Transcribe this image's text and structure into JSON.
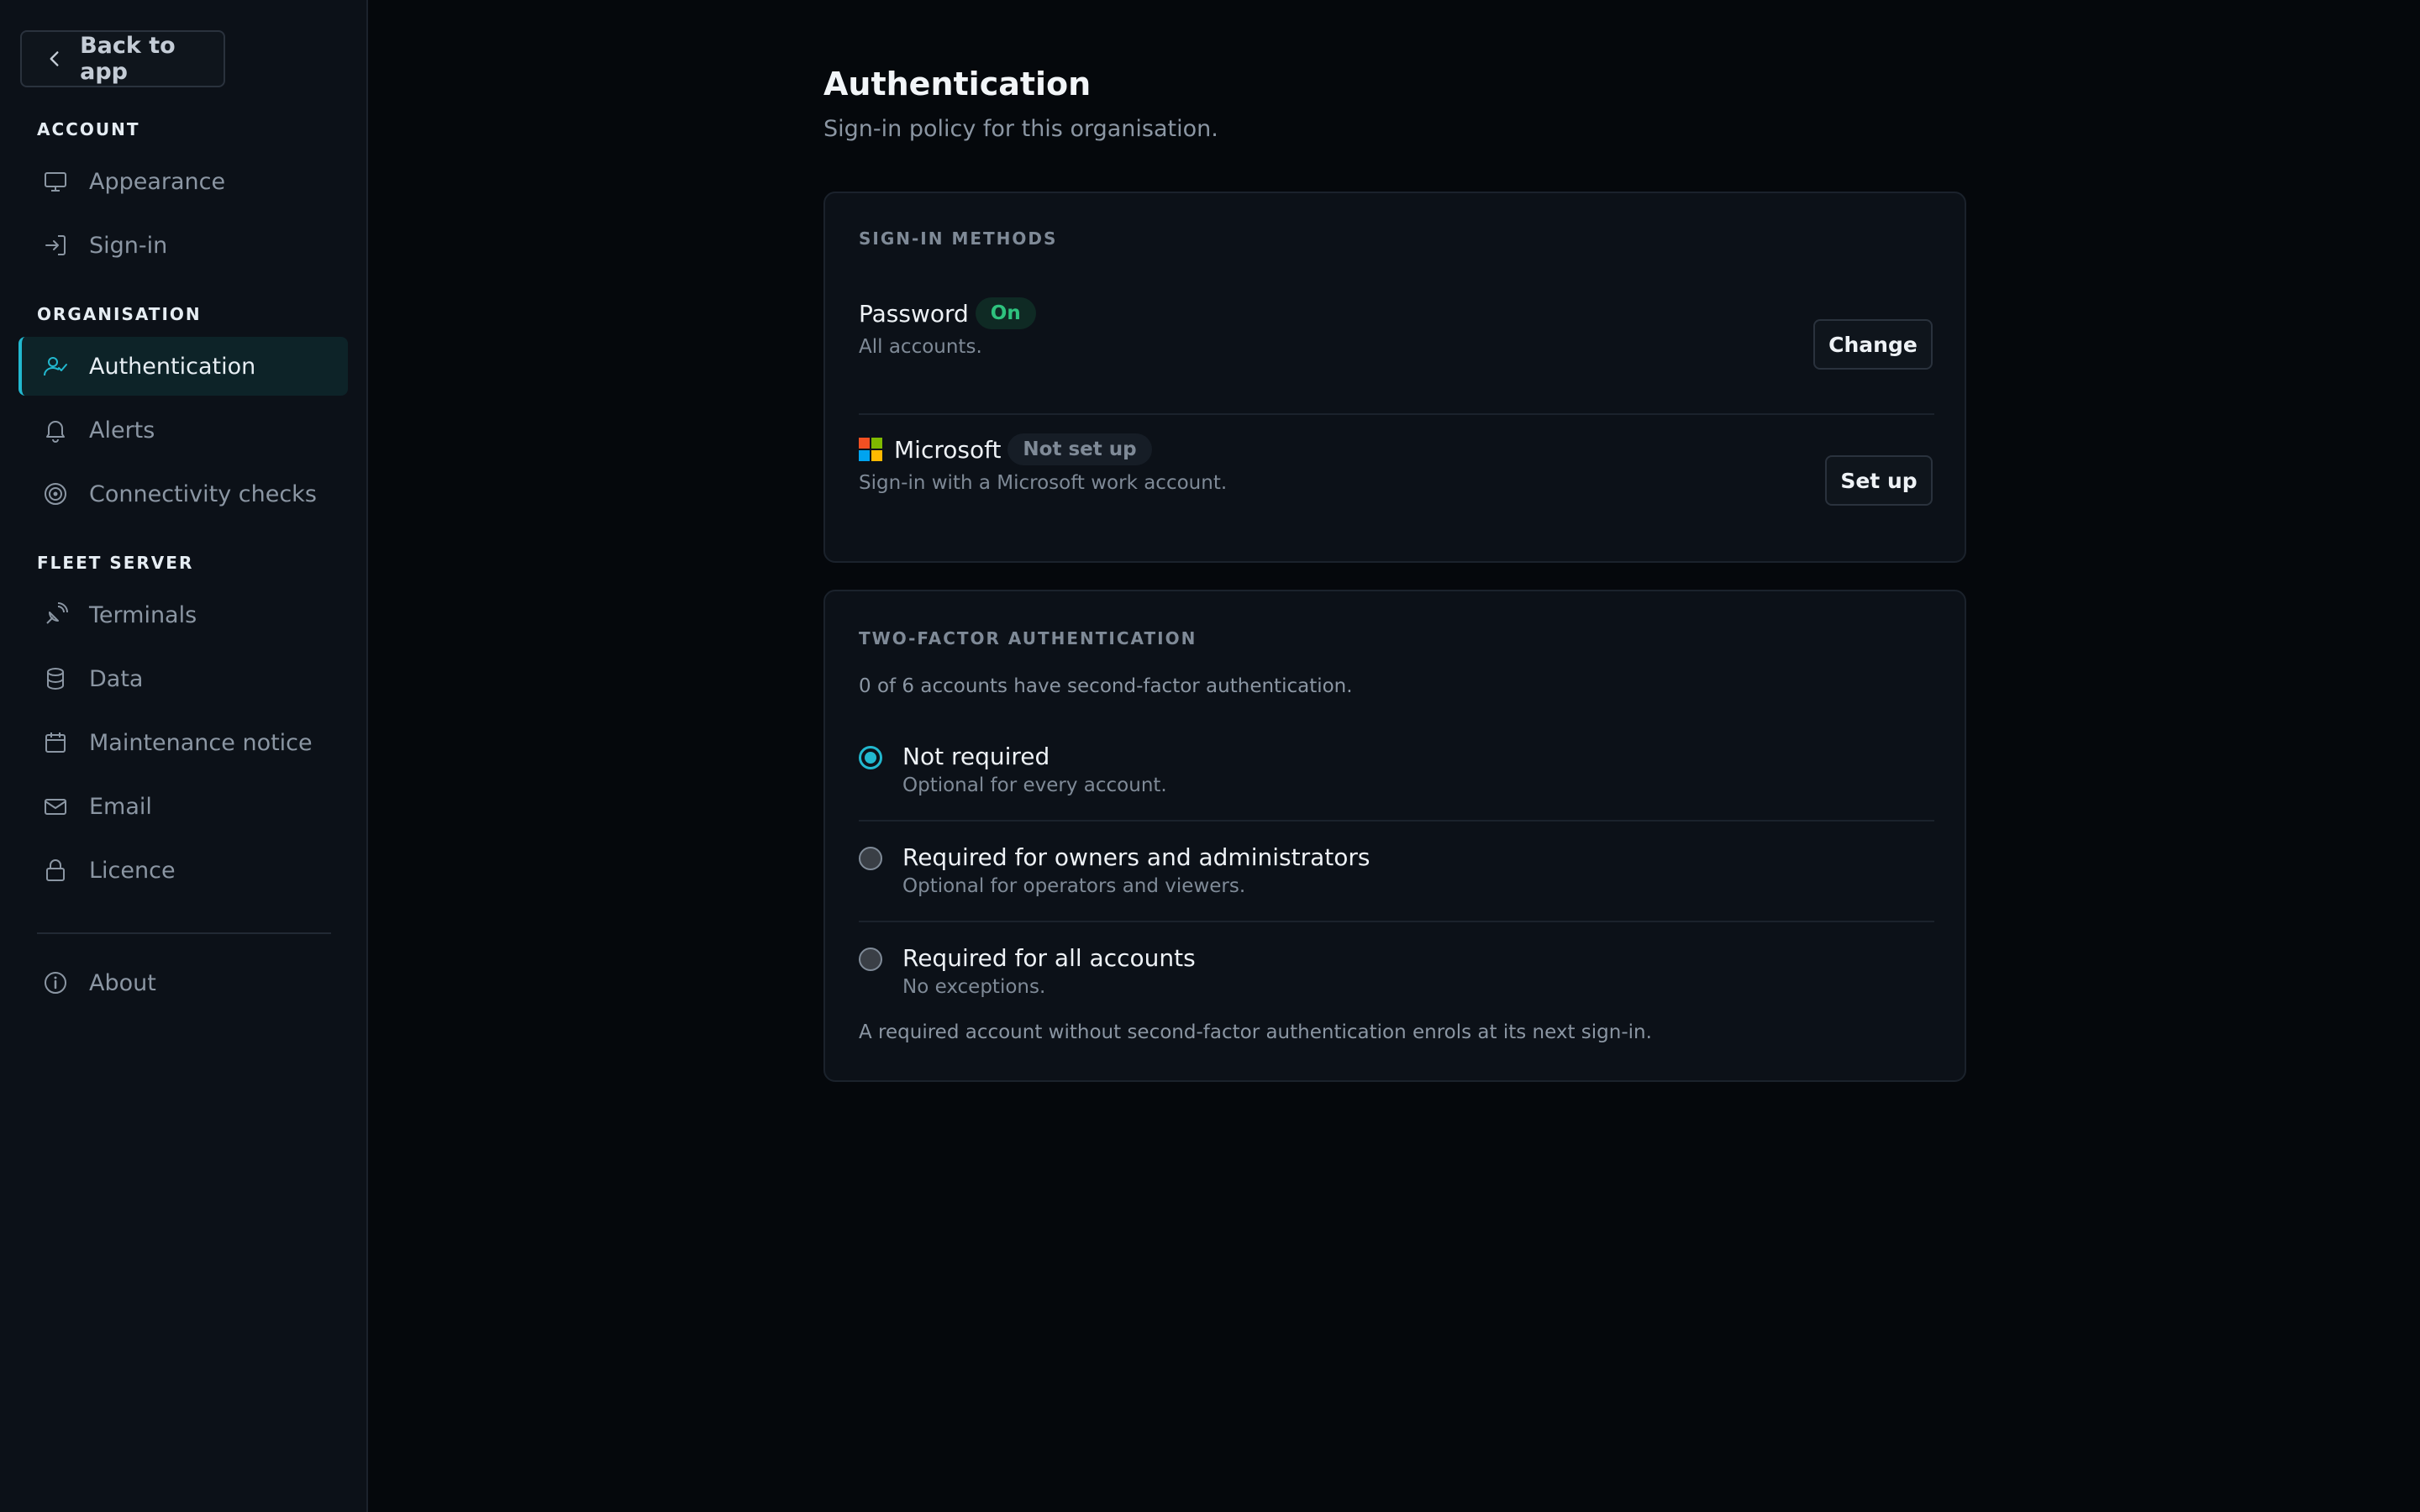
{
  "sidebar": {
    "back_label": "Back to app",
    "sections": {
      "account": "ACCOUNT",
      "organisation": "ORGANISATION",
      "fleet_server": "FLEET SERVER"
    },
    "items": {
      "appearance": "Appearance",
      "signin": "Sign-in",
      "authentication": "Authentication",
      "alerts": "Alerts",
      "connectivity": "Connectivity checks",
      "terminals": "Terminals",
      "data": "Data",
      "maintenance": "Maintenance notice",
      "email": "Email",
      "licence": "Licence",
      "about": "About"
    },
    "active_item": "Authentication"
  },
  "main": {
    "title": "Authentication",
    "subtitle": "Sign-in policy for this organisation."
  },
  "signin_methods": {
    "heading": "SIGN-IN METHODS",
    "password": {
      "name": "Password",
      "status": "On",
      "description": "All accounts.",
      "button": "Change"
    },
    "microsoft": {
      "name": "Microsoft",
      "status": "Not set up",
      "description": "Sign-in with a Microsoft work account.",
      "button": "Set up"
    }
  },
  "two_factor": {
    "heading": "TWO-FACTOR AUTHENTICATION",
    "summary": "0 of 6 accounts have second-factor authentication.",
    "options": [
      {
        "label": "Not required",
        "description": "Optional for every account.",
        "selected": true
      },
      {
        "label": "Required for owners and administrators",
        "description": "Optional for operators and viewers.",
        "selected": false
      },
      {
        "label": "Required for all accounts",
        "description": "No exceptions.",
        "selected": false
      }
    ],
    "footnote": "A required account without second-factor authentication enrols at its next sign-in."
  },
  "colors": {
    "accent": "#22b8cf",
    "status_on": "#2ec27e",
    "background": "#05080c",
    "panel": "#0c1118"
  },
  "icons": {
    "back": "chevron-left-icon",
    "appearance": "monitor-icon",
    "signin": "login-icon",
    "authentication": "user-check-icon",
    "alerts": "bell-icon",
    "connectivity": "target-icon",
    "terminals": "satellite-icon",
    "data": "database-icon",
    "maintenance": "calendar-icon",
    "email": "mail-icon",
    "licence": "lock-icon",
    "about": "info-icon",
    "microsoft": "microsoft-logo-icon"
  }
}
